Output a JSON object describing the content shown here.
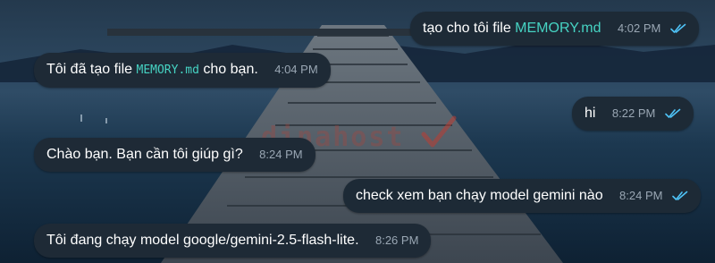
{
  "colors": {
    "bubble_bg": "#1e2a36",
    "highlight": "#46d3c3",
    "check_color": "#4fc3f7",
    "time_color": "#9aa7b4"
  },
  "watermark": {
    "text": "dinahost"
  },
  "messages": [
    {
      "direction": "outgoing",
      "parts": {
        "pre": "tạo cho tôi file ",
        "code": "MEMORY.md"
      },
      "time": "4:02 PM",
      "status_icon": "double-check-icon"
    },
    {
      "direction": "incoming",
      "parts": {
        "pre": "Tôi đã tạo file ",
        "code": "MEMORY.md",
        "post": " cho bạn."
      },
      "time": "4:04 PM"
    },
    {
      "direction": "outgoing",
      "text": "hi",
      "time": "8:22 PM",
      "status_icon": "double-check-icon"
    },
    {
      "direction": "incoming",
      "text": "Chào bạn. Bạn cần tôi giúp gì?",
      "time": "8:24 PM"
    },
    {
      "direction": "outgoing",
      "text": "check xem bạn chạy model gemini nào",
      "time": "8:24 PM",
      "status_icon": "double-check-icon"
    },
    {
      "direction": "incoming",
      "text": "Tôi đang chạy model google/gemini-2.5-flash-lite.",
      "time": "8:26 PM"
    }
  ]
}
